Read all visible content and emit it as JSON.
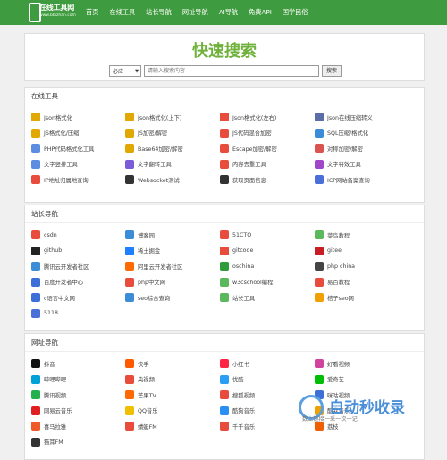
{
  "header": {
    "logo_title": "在线工具网",
    "logo_sub": "www.bbizhan.com",
    "nav": [
      "首页",
      "在线工具",
      "站长导航",
      "网址导航",
      "AI导航",
      "免费API",
      "国学民俗"
    ]
  },
  "search": {
    "title": "快速搜索",
    "engine": "必应",
    "placeholder": "请输入搜索内容",
    "button": "搜索"
  },
  "sections": {
    "tools": {
      "title": "在线工具",
      "items": [
        {
          "label": "Json格式化",
          "icon": "json-icon",
          "color": "#e0a800"
        },
        {
          "label": "Json格式化(上下)",
          "icon": "json-icon",
          "color": "#e0a800"
        },
        {
          "label": "Json格式化(左右)",
          "icon": "json-lr-icon",
          "color": "#e74c3c"
        },
        {
          "label": "Json在线压缩转义",
          "icon": "compress-icon",
          "color": "#5b6ea8"
        },
        {
          "label": "JS格式化/压缩",
          "icon": "js-icon",
          "color": "#e0a800"
        },
        {
          "label": "JS加密/解密",
          "icon": "js-icon",
          "color": "#e0a800"
        },
        {
          "label": "JS代码混合加密",
          "icon": "mix-icon",
          "color": "#e74c3c"
        },
        {
          "label": "SQL压缩/格式化",
          "icon": "sql-icon",
          "color": "#3c8dd8"
        },
        {
          "label": "PHP代码格式化工具",
          "icon": "php-icon",
          "color": "#5b8de0"
        },
        {
          "label": "Base64加密/解密",
          "icon": "base64-icon",
          "color": "#e0a800"
        },
        {
          "label": "Escape加密/解密",
          "icon": "escape-icon",
          "color": "#e74c3c"
        },
        {
          "label": "对称加密/解密",
          "icon": "crypt-icon",
          "color": "#d9534f"
        },
        {
          "label": "文字竖排工具",
          "icon": "text-icon",
          "color": "#5b8de0"
        },
        {
          "label": "文字翻转工具",
          "icon": "flip-icon",
          "color": "#7a5bd8"
        },
        {
          "label": "内容去重工具",
          "icon": "dedupe-icon",
          "color": "#e74c3c"
        },
        {
          "label": "文字特效工具",
          "icon": "effect-icon",
          "color": "#a046c8"
        },
        {
          "label": "IP地址归属地查询",
          "icon": "ip-icon",
          "color": "#e74c3c"
        },
        {
          "label": "Websocket测试",
          "icon": "websocket-icon",
          "color": "#333333"
        },
        {
          "label": "获取页面信息",
          "icon": "page-icon",
          "color": "#333333"
        },
        {
          "label": "ICP网站备案查询",
          "icon": "icp-icon",
          "color": "#4a6fd8"
        }
      ]
    },
    "webmaster": {
      "title": "站长导航",
      "items": [
        {
          "label": "csdn",
          "icon": "csdn-icon",
          "color": "#e74c3c"
        },
        {
          "label": "博客园",
          "icon": "cnblogs-icon",
          "color": "#3c8dd8"
        },
        {
          "label": "51CTO",
          "icon": "51cto-icon",
          "color": "#e74c3c"
        },
        {
          "label": "菜鸟教程",
          "icon": "runoob-icon",
          "color": "#5cb85c"
        },
        {
          "label": "github",
          "icon": "github-icon",
          "color": "#222222"
        },
        {
          "label": "稀土掘金",
          "icon": "juejin-icon",
          "color": "#1e80ff"
        },
        {
          "label": "gitcode",
          "icon": "gitcode-icon",
          "color": "#e74c3c"
        },
        {
          "label": "gitee",
          "icon": "gitee-icon",
          "color": "#c71d23"
        },
        {
          "label": "腾讯云开发者社区",
          "icon": "tencent-cloud-icon",
          "color": "#3c8dd8"
        },
        {
          "label": "阿里云开发者社区",
          "icon": "aliyun-icon",
          "color": "#ff6a00"
        },
        {
          "label": "oschina",
          "icon": "oschina-icon",
          "color": "#2e9d3a"
        },
        {
          "label": "php china",
          "icon": "phpchina-icon",
          "color": "#444444"
        },
        {
          "label": "百度开发者中心",
          "icon": "baidu-icon",
          "color": "#3c6fd8"
        },
        {
          "label": "php中文网",
          "icon": "phpcn-icon",
          "color": "#e74c3c"
        },
        {
          "label": "w3cschool编程",
          "icon": "w3c-icon",
          "color": "#5cb85c"
        },
        {
          "label": "易百教程",
          "icon": "yiibai-icon",
          "color": "#e74c3c"
        },
        {
          "label": "c语言中文网",
          "icon": "c-icon",
          "color": "#3c6fd8"
        },
        {
          "label": "seo综合查询",
          "icon": "seo-icon",
          "color": "#3c8dd8"
        },
        {
          "label": "站长工具",
          "icon": "chinaz-icon",
          "color": "#5cb85c"
        },
        {
          "label": "桔子seo网",
          "icon": "juzi-icon",
          "color": "#f0a000"
        },
        {
          "label": "5118",
          "icon": "5118-icon",
          "color": "#4a6fd8"
        }
      ]
    },
    "sites": {
      "title": "网址导航",
      "items": [
        {
          "label": "抖音",
          "icon": "douyin-icon",
          "color": "#111111"
        },
        {
          "label": "快手",
          "icon": "kuaishou-icon",
          "color": "#ff5a00"
        },
        {
          "label": "小红书",
          "icon": "xiaohongshu-icon",
          "color": "#ff2442"
        },
        {
          "label": "好看视频",
          "icon": "haokan-icon",
          "color": "#d0439e"
        },
        {
          "label": "哔哩哔哩",
          "icon": "bilibili-icon",
          "color": "#00a1d6"
        },
        {
          "label": "央视频",
          "icon": "cctv-icon",
          "color": "#e74c3c"
        },
        {
          "label": "优酷",
          "icon": "youku-icon",
          "color": "#2a9df4"
        },
        {
          "label": "爱奇艺",
          "icon": "iqiyi-icon",
          "color": "#00be06"
        },
        {
          "label": "腾讯视频",
          "icon": "tencent-video-icon",
          "color": "#22b14c"
        },
        {
          "label": "芒果TV",
          "icon": "mgtv-icon",
          "color": "#ff6a00"
        },
        {
          "label": "搜狐视频",
          "icon": "sohu-icon",
          "color": "#e74c3c"
        },
        {
          "label": "咪咕视频",
          "icon": "migu-icon",
          "color": "#3c6fd8"
        },
        {
          "label": "网易云音乐",
          "icon": "netease-music-icon",
          "color": "#e02020"
        },
        {
          "label": "QQ音乐",
          "icon": "qqmusic-icon",
          "color": "#f0c000"
        },
        {
          "label": "酷狗音乐",
          "icon": "kugou-icon",
          "color": "#2a8ff4"
        },
        {
          "label": "酷我音乐",
          "icon": "kuwo-icon",
          "color": "#f0a000"
        },
        {
          "label": "喜马拉雅",
          "icon": "ximalaya-icon",
          "color": "#f05a28"
        },
        {
          "label": "蜻蜓FM",
          "icon": "qingting-icon",
          "color": "#e74c3c"
        },
        {
          "label": "千千音乐",
          "icon": "qianqian-icon",
          "color": "#e74c3c"
        },
        {
          "label": "荔枝",
          "icon": "lizhi-icon",
          "color": "#f06000"
        },
        {
          "label": "猫耳FM",
          "icon": "maoer-icon",
          "color": "#333333"
        }
      ]
    }
  },
  "watermark": {
    "title": "自动秒收录",
    "subtitle": "数上链接一采一次一记"
  }
}
